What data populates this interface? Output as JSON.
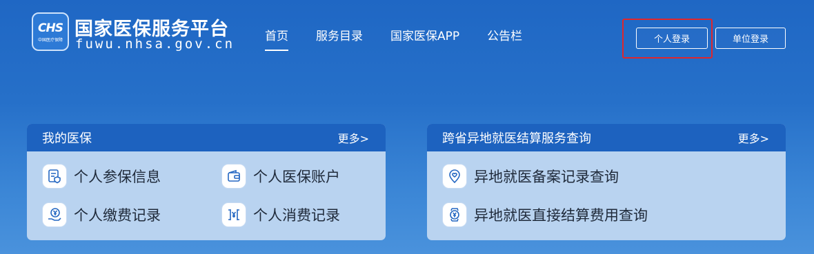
{
  "brand": {
    "logo_text": "CHS",
    "logo_subtext": "中国医疗保障",
    "title": "国家医保服务平台",
    "domain": "fuwu.nhsa.gov.cn"
  },
  "nav": {
    "items": [
      {
        "label": "首页",
        "active": true
      },
      {
        "label": "服务目录"
      },
      {
        "label": "国家医保APP"
      },
      {
        "label": "公告栏"
      }
    ]
  },
  "login": {
    "personal": "个人登录",
    "unit": "单位登录"
  },
  "my_insurance": {
    "title": "我的医保",
    "more": "更多>",
    "items": [
      {
        "label": "个人参保信息",
        "icon": "document-shield-icon"
      },
      {
        "label": "个人医保账户",
        "icon": "wallet-icon"
      },
      {
        "label": "个人缴费记录",
        "icon": "hand-yuan-icon"
      },
      {
        "label": "个人消费记录",
        "icon": "receipt-yuan-icon"
      }
    ]
  },
  "cross_province": {
    "title": "跨省异地就医结算服务查询",
    "more": "更多>",
    "items": [
      {
        "label": "异地就医备案记录查询",
        "icon": "location-heart-icon"
      },
      {
        "label": "异地就医直接结算费用查询",
        "icon": "watch-yuan-icon"
      }
    ]
  },
  "colors": {
    "header_bar": "#1d62bf",
    "card_body": "#b9d3f0",
    "highlight": "#e0262b",
    "icon_stroke": "#2467c2"
  }
}
